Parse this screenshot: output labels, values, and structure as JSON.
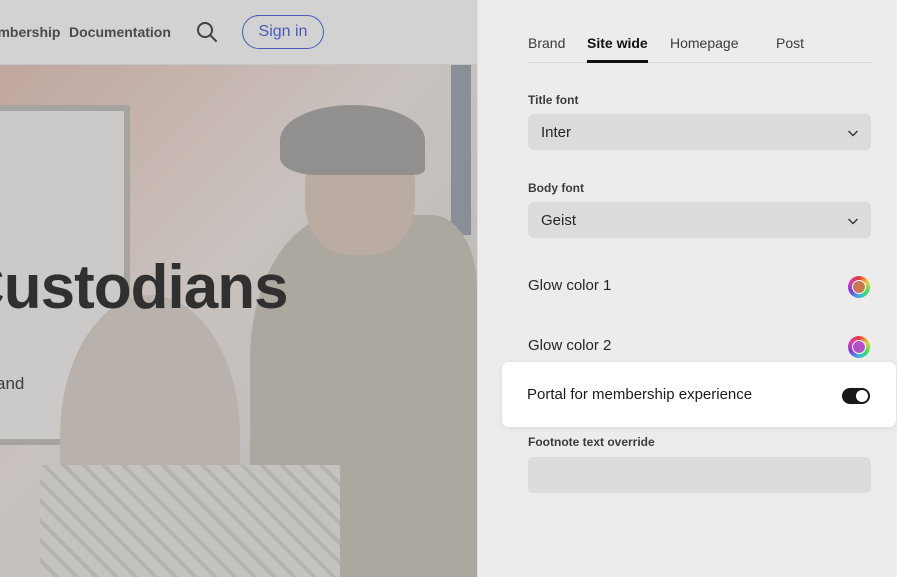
{
  "preview": {
    "nav": {
      "membership_link": "Membership",
      "documentation_link": "Documentation",
      "search_icon": "search-icon",
      "signin_label": "Sign in"
    },
    "hero": {
      "title_fragment": "Custodians",
      "subtitle_fragment": "and"
    }
  },
  "settings": {
    "tabs": [
      {
        "label": "Brand",
        "active": false
      },
      {
        "label": "Site wide",
        "active": true
      },
      {
        "label": "Homepage",
        "active": false
      },
      {
        "label": "Post",
        "active": false
      }
    ],
    "title_font": {
      "label": "Title font",
      "value": "Inter"
    },
    "body_font": {
      "label": "Body font",
      "value": "Geist"
    },
    "glow_color_1": {
      "label": "Glow color 1",
      "color": "#c9774f"
    },
    "glow_color_2": {
      "label": "Glow color 2",
      "color": "#b84fc9"
    },
    "portal_toggle": {
      "label": "Portal for membership experience",
      "on": true
    },
    "footnote": {
      "label": "Footnote text override",
      "value": ""
    }
  },
  "colors": {
    "accent": "#3b4fd6",
    "toggle_on": "#15171a"
  }
}
